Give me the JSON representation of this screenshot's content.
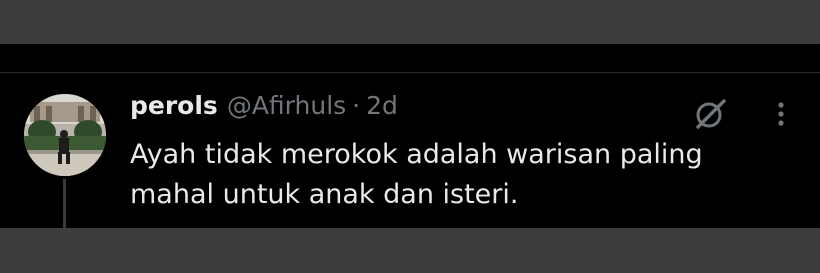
{
  "tweet": {
    "display_name": "perols",
    "handle": "@Afirhuls",
    "separator": "·",
    "time": "2d",
    "text": "Ayah tidak merokok adalah warisan paling mahal untuk anak dan isteri."
  },
  "icons": {
    "grok": "grok-icon",
    "more": "more-options-icon"
  },
  "colors": {
    "background": "#000000",
    "text_primary": "#e7e9ea",
    "text_secondary": "#71767b"
  }
}
